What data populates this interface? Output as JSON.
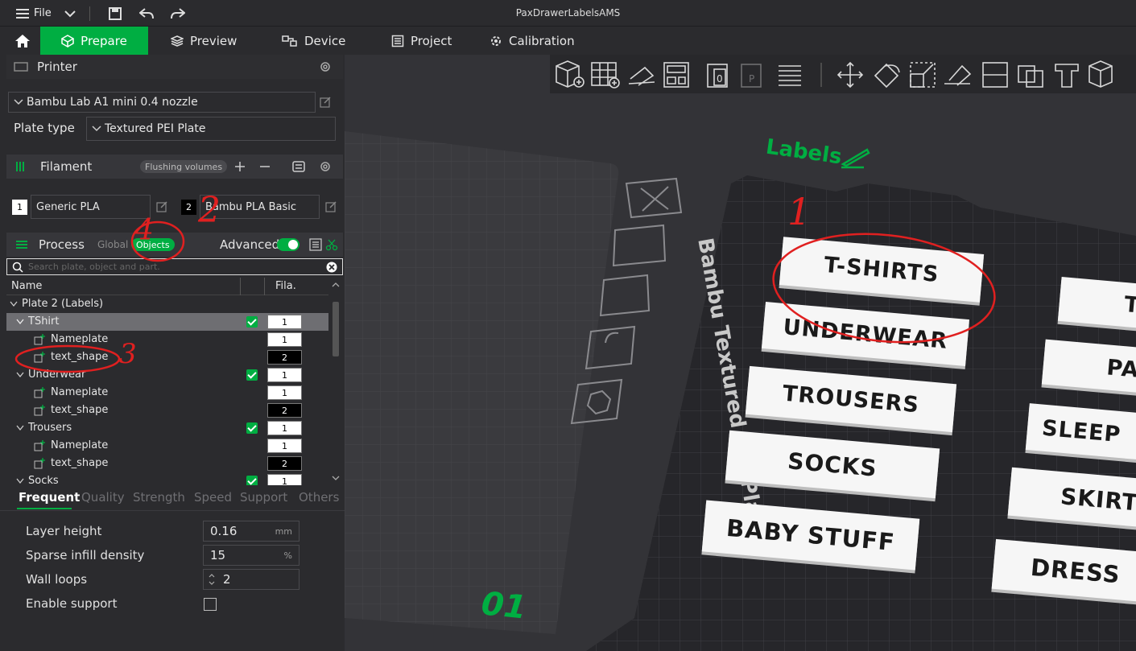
{
  "titlebar": {
    "file_label": "File",
    "window_title": "PaxDrawerLabelsAMS"
  },
  "tabs": [
    {
      "label": "Prepare"
    },
    {
      "label": "Preview"
    },
    {
      "label": "Device"
    },
    {
      "label": "Project"
    },
    {
      "label": "Calibration"
    }
  ],
  "printer": {
    "section_title": "Printer",
    "printer_name": "Bambu Lab A1 mini 0.4 nozzle",
    "plate_type_label": "Plate type",
    "plate_type_value": "Textured PEI Plate"
  },
  "filament": {
    "section_title": "Filament",
    "flushing_label": "Flushing volumes",
    "items": [
      {
        "index": "1",
        "name": "Generic PLA"
      },
      {
        "index": "2",
        "name": "Bambu PLA Basic"
      }
    ]
  },
  "process": {
    "section_title": "Process",
    "global_label": "Global",
    "objects_label": "Objects",
    "advanced_label": "Advanced",
    "search_placeholder": "Search plate, object and part."
  },
  "tree": {
    "col_name": "Name",
    "col_fila": "Fila.",
    "plate": "Plate 2 (Labels)",
    "rows": [
      {
        "name": "TShirt",
        "fila": "1"
      },
      {
        "name": "Nameplate",
        "fila": "1"
      },
      {
        "name": "text_shape",
        "fila": "2"
      },
      {
        "name": "Underwear",
        "fila": "1"
      },
      {
        "name": "Nameplate",
        "fila": "1"
      },
      {
        "name": "text_shape",
        "fila": "2"
      },
      {
        "name": "Trousers",
        "fila": "1"
      },
      {
        "name": "Nameplate",
        "fila": "1"
      },
      {
        "name": "text_shape",
        "fila": "2"
      },
      {
        "name": "Socks",
        "fila": "1"
      }
    ]
  },
  "param_tabs": [
    "Frequent",
    "Quality",
    "Strength",
    "Speed",
    "Support",
    "Others"
  ],
  "params": [
    {
      "label": "Layer height",
      "value": "0.16",
      "unit": "mm"
    },
    {
      "label": "Sparse infill density",
      "value": "15",
      "unit": "%"
    },
    {
      "label": "Wall loops",
      "value": "2",
      "unit": ""
    },
    {
      "label": "Enable support",
      "value": "",
      "unit": ""
    }
  ],
  "viewport": {
    "plate_name": "Labels",
    "plate_number": "01",
    "bed_text": "Bambu Textured PEI Plate",
    "labels_left": [
      "T-SHIRTS",
      "UNDERWEAR",
      "TROUSERS",
      "SOCKS",
      "BABY STUFF"
    ],
    "labels_right": [
      "T",
      "PAJ",
      "SLEEP",
      "SKIRT",
      "DRESS"
    ]
  },
  "annotations": [
    "1",
    "2",
    "3",
    "4"
  ],
  "colors": {
    "accent": "#00ae42",
    "panel": "#2b2b2e",
    "viewport": "#333337",
    "annotation": "#e02020"
  }
}
